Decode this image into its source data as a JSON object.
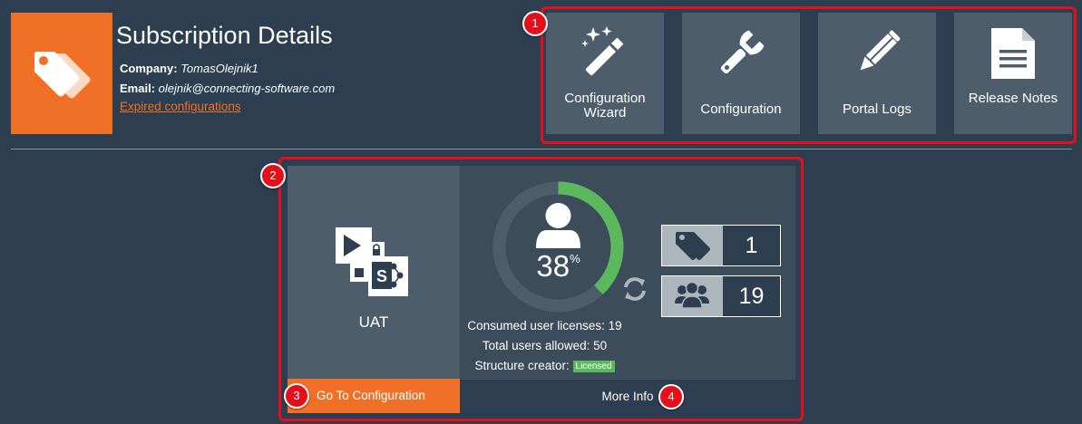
{
  "header": {
    "title": "Subscription Details",
    "company_label": "Company:",
    "company_value": "TomasOlejnik1",
    "email_label": "Email:",
    "email_value": "olejnik@connecting-software.com",
    "expired_link": "Expired configurations",
    "logo_icon": "tags-icon",
    "accent_color": "#f07027"
  },
  "toolbar": {
    "tiles": [
      {
        "label": "Configuration Wizard",
        "icon": "magic-wand-icon"
      },
      {
        "label": "Configuration",
        "icon": "wrench-icon"
      },
      {
        "label": "Portal Logs",
        "icon": "pencil-icon"
      },
      {
        "label": "Release Notes",
        "icon": "document-icon"
      }
    ]
  },
  "annotations": [
    "1",
    "2",
    "3",
    "4"
  ],
  "card": {
    "name": "UAT",
    "app_icon": "dynamics-sharepoint-icon",
    "gauge_percent": 38,
    "gauge_percent_text": "38",
    "percent_sign": "%",
    "stats": [
      {
        "icon": "tag-icon",
        "value": "1"
      },
      {
        "icon": "users-icon",
        "value": "19"
      }
    ],
    "consumed_label": "Consumed user licenses: 19",
    "total_label": "Total users allowed: 50",
    "structure_label": "Structure creator:",
    "licensed_badge": "Licensed",
    "go_button": "Go To Configuration",
    "more_button": "More Info"
  },
  "colors": {
    "background": "#2c3e50",
    "tile": "#4e5d6c",
    "highlight": "#e3101a",
    "gauge_fill": "#5cb85c",
    "gauge_track": "#4e5d6c"
  }
}
